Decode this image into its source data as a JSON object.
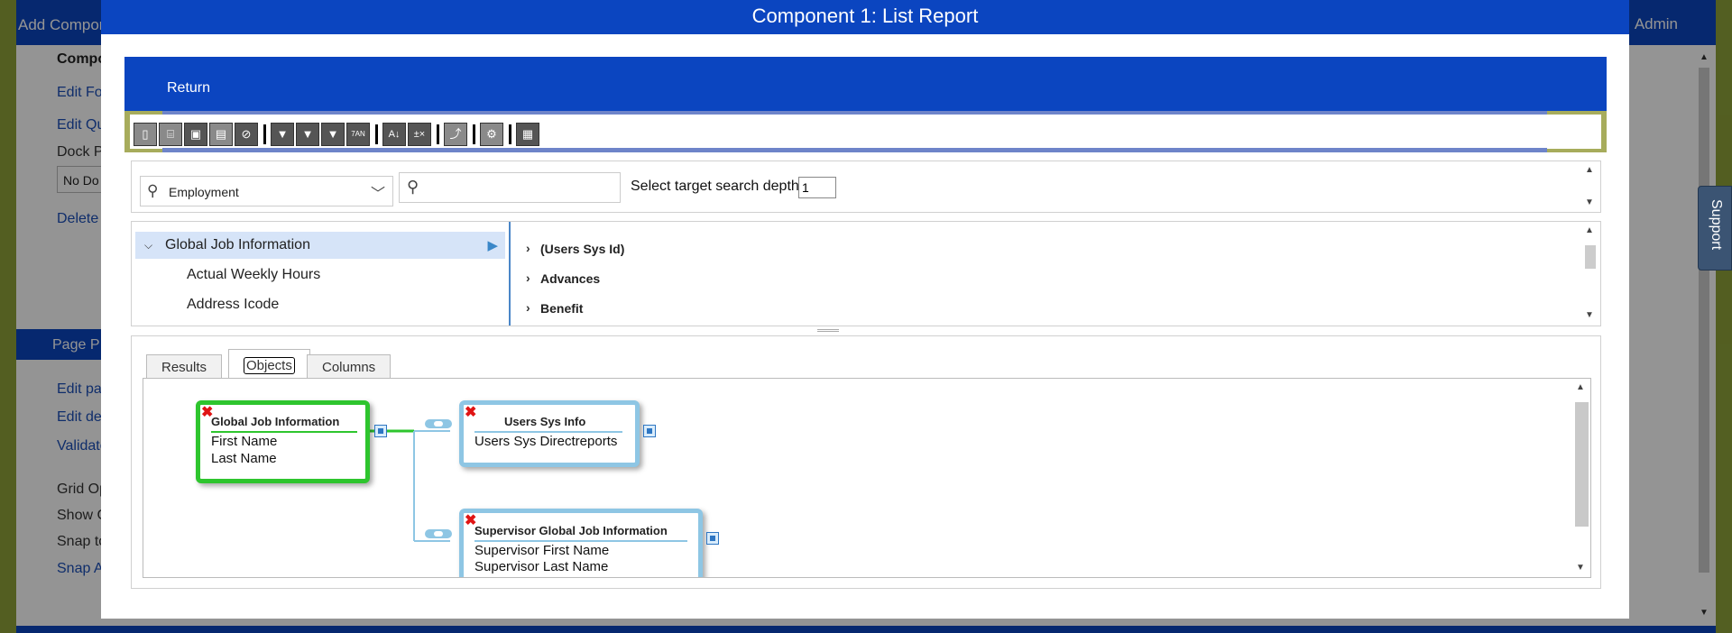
{
  "background": {
    "topbar_left": "Add Compon",
    "topbar_right": "Admin",
    "menu_items": [
      "Compo",
      "Edit Fo",
      "Edit Qu",
      "Dock P"
    ],
    "dock_value": "No Do",
    "delete_label": "Delete",
    "section_title": "Page P",
    "page_items": [
      "Edit pag",
      "Edit des",
      "Validate",
      "Grid Op",
      "Show G",
      "Snap to",
      "Snap Al"
    ]
  },
  "support_label": "Support",
  "modal": {
    "title": "Component 1: List Report",
    "return_label": "Return",
    "search": {
      "object_value": "Employment",
      "query_value": "",
      "depth_label": "Select target search depth:",
      "depth_value": "1"
    },
    "tree": {
      "left_items": [
        {
          "label": "Global Job Information",
          "selected": true
        },
        {
          "label": "Actual Weekly Hours",
          "selected": false
        },
        {
          "label": "Address Icode",
          "selected": false
        }
      ],
      "right_items": [
        "(Users Sys Id)",
        "Advances",
        "Benefit"
      ]
    },
    "tabs": [
      "Results",
      "Objects",
      "Columns"
    ],
    "active_tab": "Objects",
    "diagram": {
      "nodes": [
        {
          "title": "Global Job Information",
          "fields": [
            "First Name",
            "Last Name"
          ],
          "border": "#2ec52e"
        },
        {
          "title": "Users Sys Info",
          "fields": [
            "Users Sys Directreports"
          ],
          "border": "#8ec6e4"
        },
        {
          "title": "Supervisor Global Job Information",
          "fields": [
            "Supervisor First Name",
            "Supervisor Last Name"
          ],
          "border": "#8ec6e4"
        }
      ]
    }
  },
  "colors": {
    "brand_blue": "#0b45c0",
    "olive_border": "#8fa33a",
    "node_green": "#2ec52e",
    "node_blue": "#8ec6e4",
    "delete_red": "#e01414"
  },
  "icons": [
    "new-icon",
    "open-icon",
    "save-icon",
    "save-as-icon",
    "cancel-icon",
    "filter-icon",
    "filter-settings-icon",
    "filter-help-icon",
    "format-icon",
    "sort-icon",
    "calculate-icon",
    "join-icon",
    "settings-icon",
    "report-schedule-icon"
  ]
}
